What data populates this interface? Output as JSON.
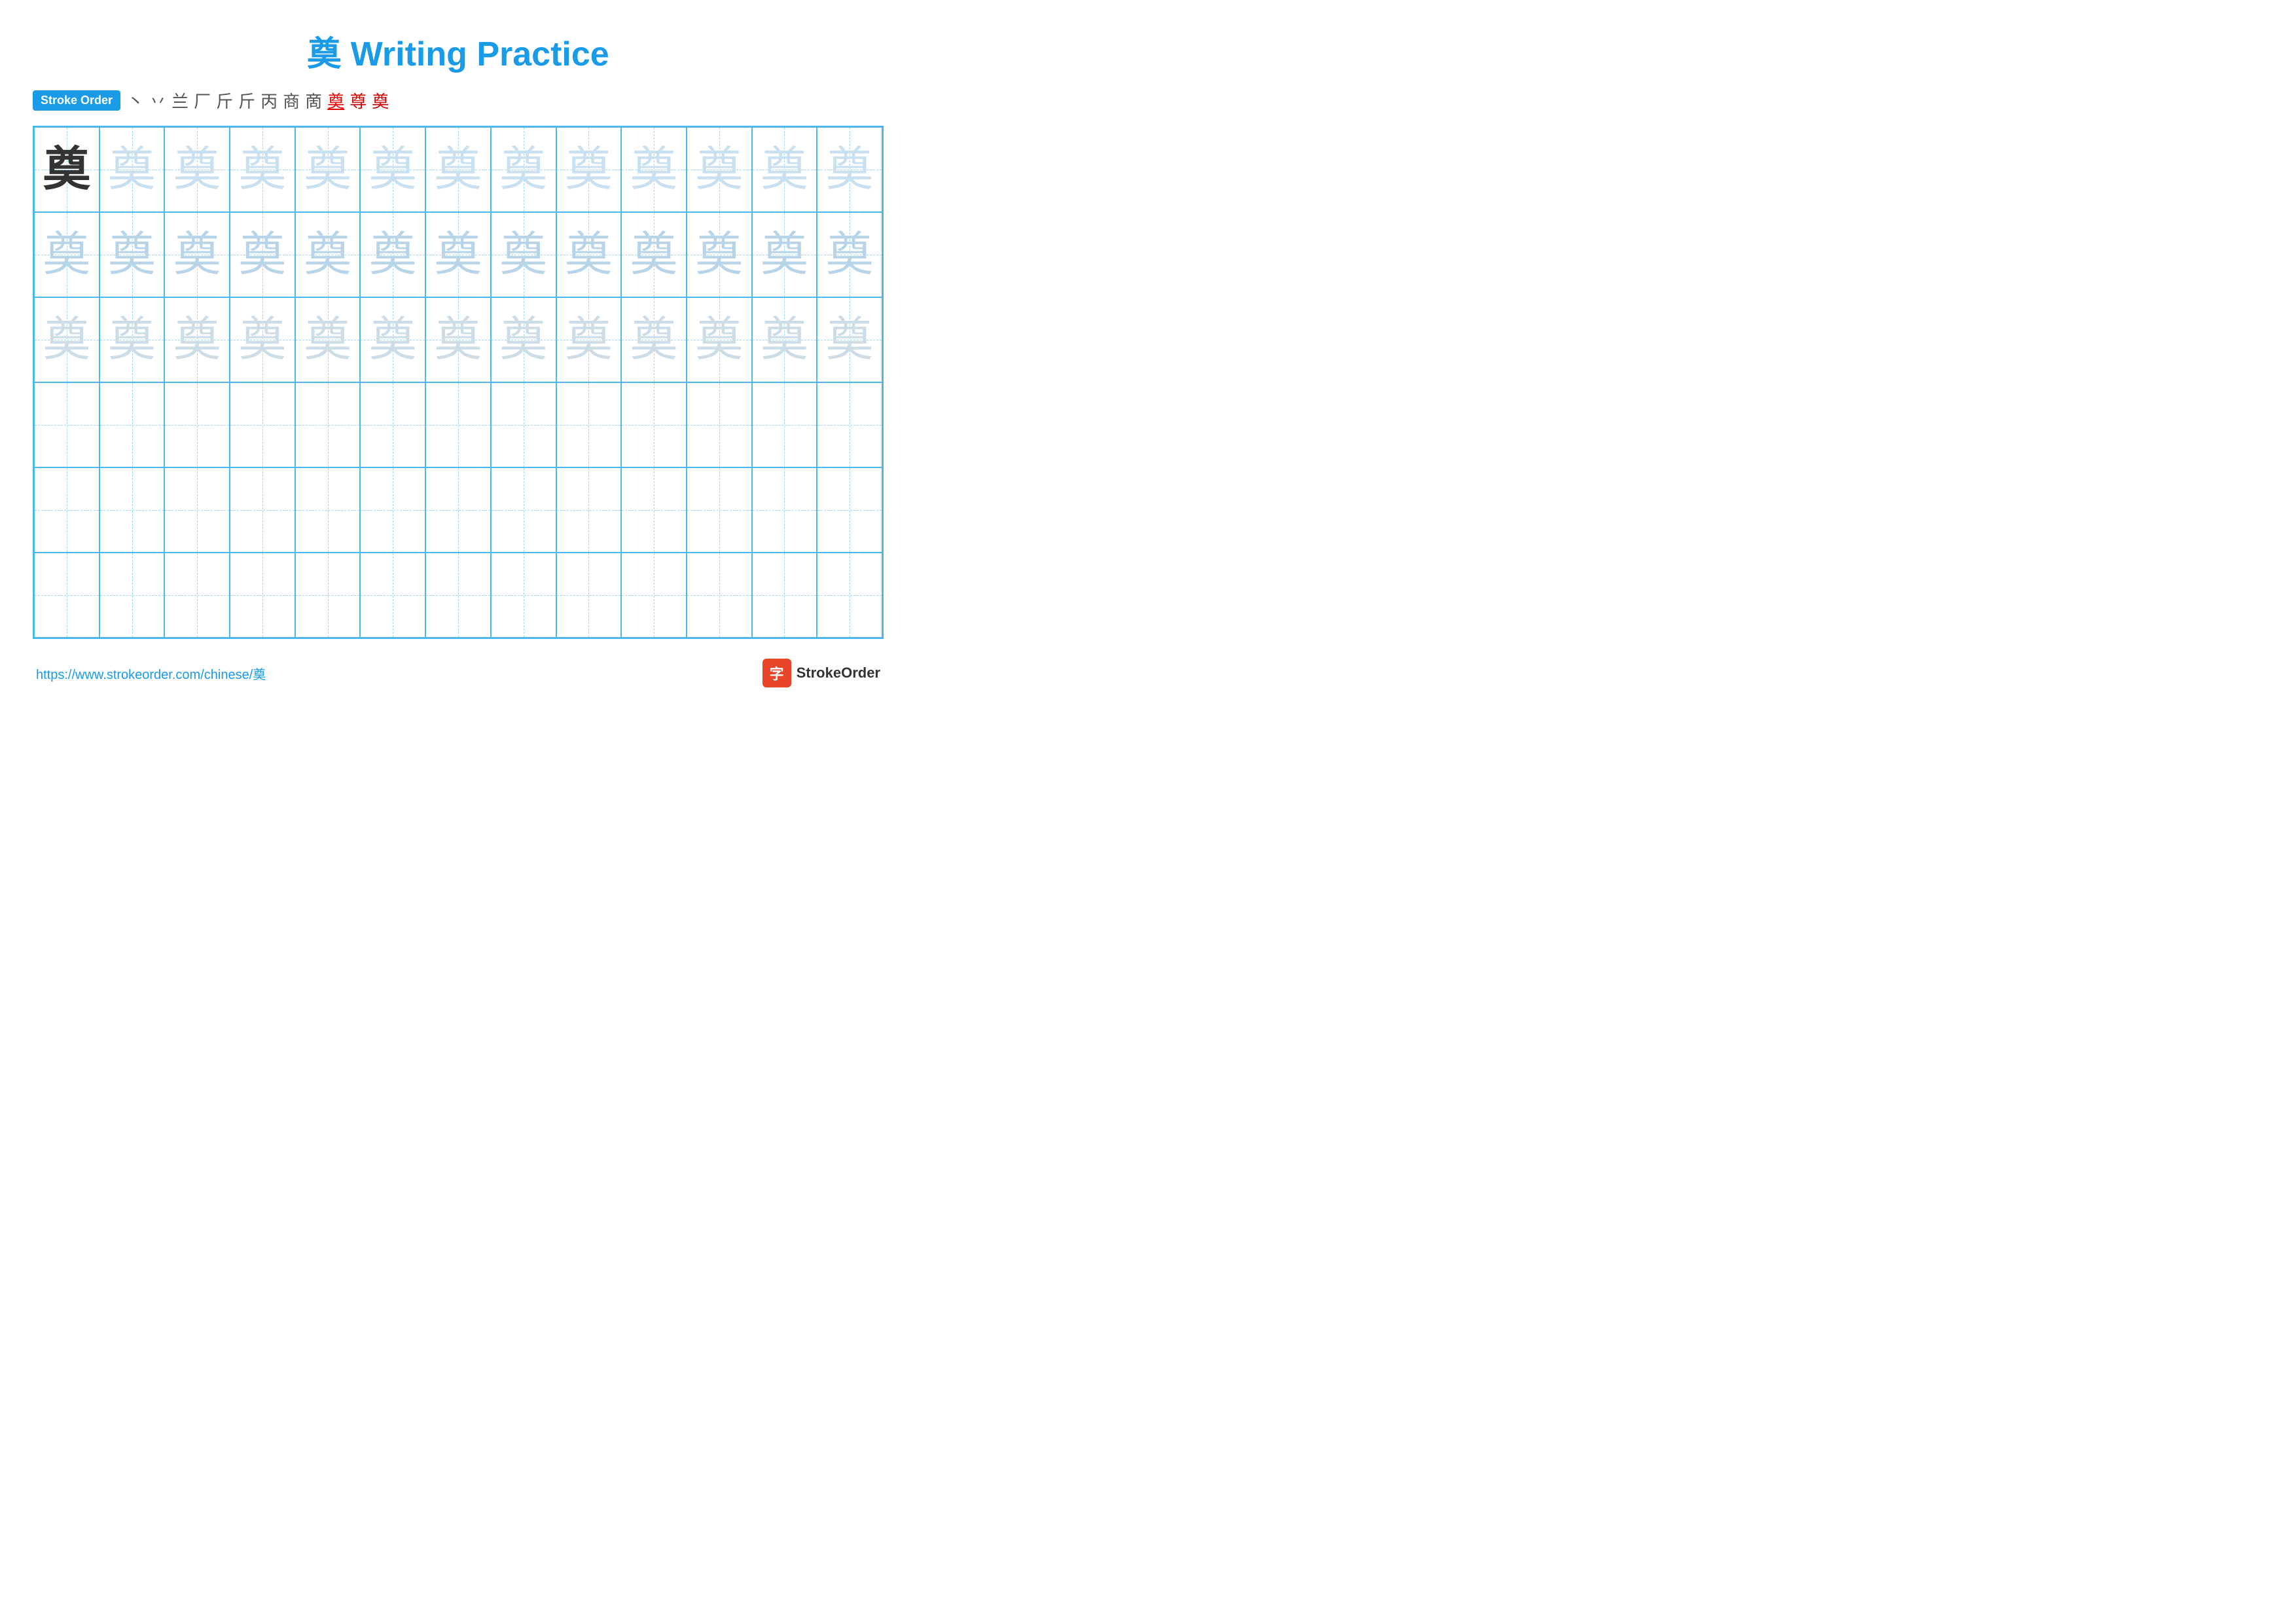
{
  "page": {
    "title": "奠 Writing Practice",
    "title_char": "奠",
    "title_suffix": " Writing Practice"
  },
  "stroke_order": {
    "badge_label": "Stroke Order",
    "strokes": [
      "丶",
      "丷",
      "兰",
      "厂",
      "斤",
      "斤",
      "丙",
      "商",
      "啇",
      "奠̲",
      "尊",
      "奠"
    ],
    "colors": [
      "dark",
      "dark",
      "dark",
      "dark",
      "dark",
      "dark",
      "dark",
      "dark",
      "dark",
      "red",
      "dark",
      "dark"
    ]
  },
  "grid": {
    "rows": 6,
    "cols": 13,
    "char": "奠",
    "filled_rows": 3
  },
  "footer": {
    "url": "https://www.strokeorder.com/chinese/奠",
    "logo_text": "StrokeOrder",
    "logo_icon": "字"
  }
}
